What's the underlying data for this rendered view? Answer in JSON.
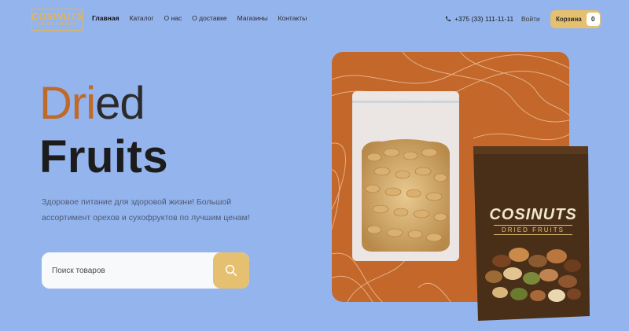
{
  "logo": {
    "main": "COSINUTS",
    "sub": "DRIED FRUITS"
  },
  "nav": [
    {
      "label": "Главная",
      "active": true
    },
    {
      "label": "Каталог",
      "active": false
    },
    {
      "label": "О нас",
      "active": false
    },
    {
      "label": "О доставке",
      "active": false
    },
    {
      "label": "Магазины",
      "active": false
    },
    {
      "label": "Контакты",
      "active": false
    }
  ],
  "header": {
    "phone": "+375 (33) 111-11-11",
    "login": "Войти",
    "cart_label": "Корзина",
    "cart_count": "0"
  },
  "hero": {
    "line1_highlight": "Dri",
    "line1_rest": "ed",
    "line2": "Fruits",
    "description": "Здоровое питание для здоровой жизни! Большой ассортимент орехов и сухофруктов по лучшим ценам!"
  },
  "search": {
    "placeholder": "Поиск товаров"
  },
  "product_bag": {
    "brand": "COSINUTS",
    "sub": "DRIED FRUITS"
  },
  "colors": {
    "background": "#94b4ee",
    "accent": "#e5c070",
    "card": "#c4672a",
    "highlight_text": "#c06a2a"
  }
}
